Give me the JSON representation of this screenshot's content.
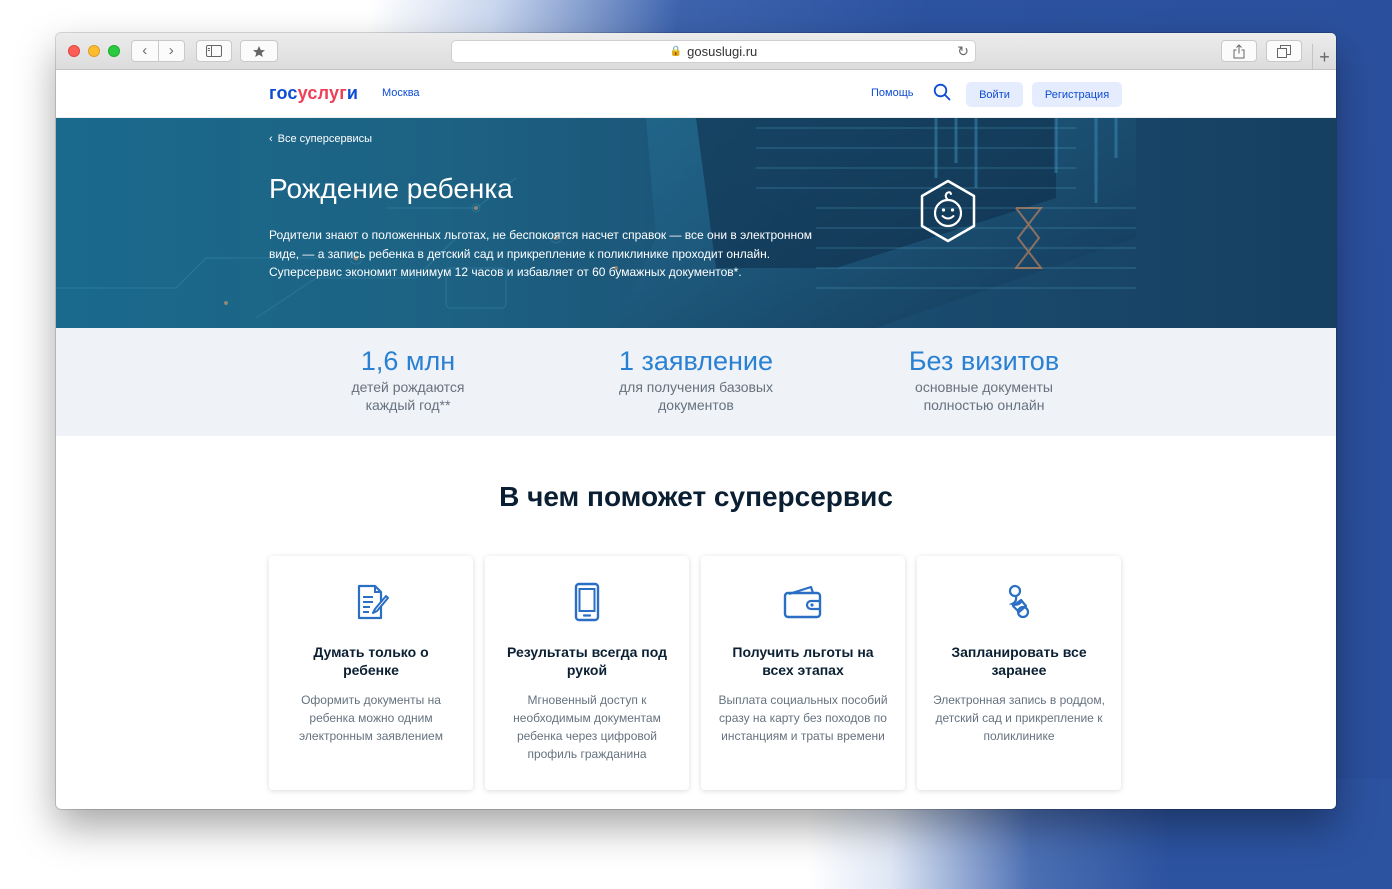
{
  "browser": {
    "url": "gosuslugi.ru"
  },
  "header": {
    "logo_part1": "гос",
    "logo_part2": "услуг",
    "logo_part3": "и",
    "city": "Москва",
    "help": "Помощь",
    "login": "Войти",
    "register": "Регистрация"
  },
  "hero": {
    "breadcrumb": "Все суперсервисы",
    "title": "Рождение ребенка",
    "description": "Родители знают о положенных льготах, не беспокоятся насчет справок — все они в электронном виде, — а запись ребенка в детский сад и прикрепление к поликлинике проходит онлайн. Суперсервис экономит минимум 12 часов и избавляет от 60 бумажных документов*."
  },
  "stats": [
    {
      "value": "1,6 млн",
      "label": "детей рождаются каждый год**"
    },
    {
      "value": "1 заявление",
      "label": "для получения базовых документов"
    },
    {
      "value": "Без визитов",
      "label": "основные документы полностью онлайн"
    }
  ],
  "section": {
    "title": "В чем поможет суперсервис"
  },
  "cards": [
    {
      "icon": "document-edit-icon",
      "title": "Думать только о ребенке",
      "text": "Оформить документы на ребенка можно одним электронным заявлением"
    },
    {
      "icon": "smartphone-icon",
      "title": "Результаты всегда под рукой",
      "text": "Мгновенный доступ к необходимым документам ребенка через цифровой профиль гражданина"
    },
    {
      "icon": "wallet-icon",
      "title": "Получить льготы на всех этапах",
      "text": "Выплата социальных пособий сразу на карту без походов по инстанциям и траты времени"
    },
    {
      "icon": "pacifier-icon",
      "title": "Запланировать все заранее",
      "text": "Электронная запись в роддом, детский сад и прикрепление к поликлинике"
    }
  ],
  "colors": {
    "brand_blue": "#0d4cd3",
    "brand_red": "#ee3f58",
    "stat_blue": "#2a81d3",
    "icon_blue": "#2a6fc4"
  }
}
